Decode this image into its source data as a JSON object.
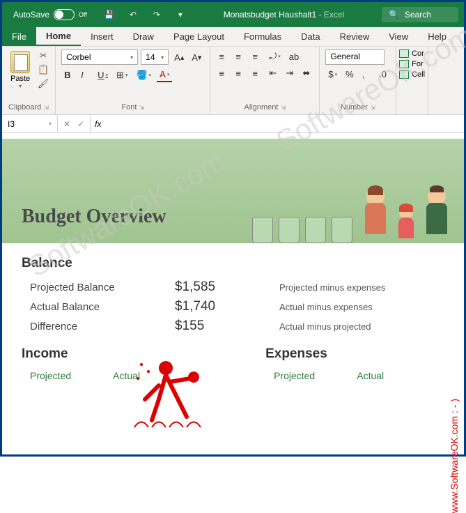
{
  "titlebar": {
    "autosave_label": "AutoSave",
    "autosave_state": "Off",
    "doc_name": "Monatsbudget Haushalt1",
    "app_name": "Excel",
    "search_placeholder": "Search"
  },
  "tabs": [
    "File",
    "Home",
    "Insert",
    "Draw",
    "Page Layout",
    "Formulas",
    "Data",
    "Review",
    "View",
    "Help"
  ],
  "ribbon": {
    "clipboard": {
      "label": "Clipboard",
      "paste": "Paste"
    },
    "font": {
      "label": "Font",
      "family": "Corbel",
      "size": "14",
      "buttons": {
        "bold": "B",
        "italic": "I",
        "underline": "U"
      }
    },
    "alignment": {
      "label": "Alignment",
      "wrap": "ab"
    },
    "number": {
      "label": "Number",
      "format": "General"
    },
    "styles": {
      "cond": "Cor",
      "format": "For",
      "cell": "Cell"
    }
  },
  "formula_bar": {
    "cell_ref": "I3",
    "fx": "fx",
    "formula": ""
  },
  "sheet": {
    "title": "Budget Overview",
    "balance_section": "Balance",
    "rows": [
      {
        "label": "Projected Balance",
        "value": "$1,585",
        "desc": "Projected minus expenses"
      },
      {
        "label": "Actual Balance",
        "value": "$1,740",
        "desc": "Actual minus expenses"
      },
      {
        "label": "Difference",
        "value": "$155",
        "desc": "Actual minus projected"
      }
    ],
    "income_section": "Income",
    "expenses_section": "Expenses",
    "sub_projected": "Projected",
    "sub_actual": "Actual"
  },
  "watermark": "SoftwareOK.com",
  "side_link": "www.SoftwareOK.com : - )"
}
